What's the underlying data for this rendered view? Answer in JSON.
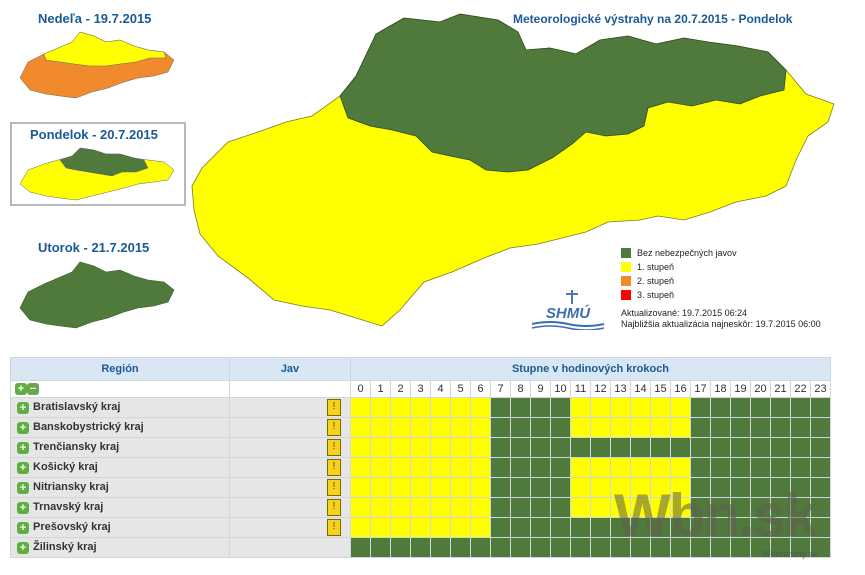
{
  "days": [
    {
      "title": "Nedeľa - 19.7.2015"
    },
    {
      "title": "Pondelok - 20.7.2015"
    },
    {
      "title": "Utorok - 21.7.2015"
    }
  ],
  "main_title": "Meteorologické výstrahy na 20.7.2015 - Pondelok",
  "legend": [
    {
      "label": "Bez nebezpečných javov",
      "color": "#4f7a3c"
    },
    {
      "label": "1. stupeň",
      "color": "#ffff00"
    },
    {
      "label": "2. stupeň",
      "color": "#f08a2c"
    },
    {
      "label": "3. stupeň",
      "color": "#ff0000"
    }
  ],
  "logo": {
    "text": "SHMÚ"
  },
  "update": {
    "updated": "Aktualizované: 19.7.2015 06:24",
    "next": "Najbližšia aktualizácia najneskôr: 19.7.2015 06:00"
  },
  "table": {
    "col_region": "Región",
    "col_jav": "Jav",
    "col_steps": "Stupne v hodinových krokoch",
    "expand_icon": "plus-icon",
    "collapse_icon": "minus-icon",
    "hazard_icon": "thermometer-icon",
    "hours": [
      "0",
      "1",
      "2",
      "3",
      "4",
      "5",
      "6",
      "7",
      "8",
      "9",
      "10",
      "11",
      "12",
      "13",
      "14",
      "15",
      "16",
      "17",
      "18",
      "19",
      "20",
      "21",
      "22",
      "23"
    ],
    "regions": [
      {
        "name": "Bratislavský kraj",
        "hazard": true,
        "levels": [
          1,
          1,
          1,
          1,
          1,
          1,
          1,
          0,
          0,
          0,
          0,
          1,
          1,
          1,
          1,
          1,
          1,
          0,
          0,
          0,
          0,
          0,
          0,
          0
        ]
      },
      {
        "name": "Banskobystrický kraj",
        "hazard": true,
        "levels": [
          1,
          1,
          1,
          1,
          1,
          1,
          1,
          0,
          0,
          0,
          0,
          1,
          1,
          1,
          1,
          1,
          1,
          0,
          0,
          0,
          0,
          0,
          0,
          0
        ]
      },
      {
        "name": "Trenčiansky kraj",
        "hazard": true,
        "levels": [
          1,
          1,
          1,
          1,
          1,
          1,
          1,
          0,
          0,
          0,
          0,
          0,
          0,
          0,
          0,
          0,
          0,
          0,
          0,
          0,
          0,
          0,
          0,
          0
        ]
      },
      {
        "name": "Košický kraj",
        "hazard": true,
        "levels": [
          1,
          1,
          1,
          1,
          1,
          1,
          1,
          0,
          0,
          0,
          0,
          1,
          1,
          1,
          1,
          1,
          1,
          0,
          0,
          0,
          0,
          0,
          0,
          0
        ]
      },
      {
        "name": "Nitriansky kraj",
        "hazard": true,
        "levels": [
          1,
          1,
          1,
          1,
          1,
          1,
          1,
          0,
          0,
          0,
          0,
          1,
          1,
          1,
          1,
          1,
          1,
          0,
          0,
          0,
          0,
          0,
          0,
          0
        ]
      },
      {
        "name": "Trnavský kraj",
        "hazard": true,
        "levels": [
          1,
          1,
          1,
          1,
          1,
          1,
          1,
          0,
          0,
          0,
          0,
          1,
          1,
          1,
          1,
          1,
          1,
          0,
          0,
          0,
          0,
          0,
          0,
          0
        ]
      },
      {
        "name": "Prešovský kraj",
        "hazard": true,
        "levels": [
          1,
          1,
          1,
          1,
          1,
          1,
          1,
          0,
          0,
          0,
          0,
          0,
          0,
          0,
          0,
          0,
          0,
          0,
          0,
          0,
          0,
          0,
          0,
          0
        ]
      },
      {
        "name": "Žilinský kraj",
        "hazard": false,
        "levels": [
          0,
          0,
          0,
          0,
          0,
          0,
          0,
          0,
          0,
          0,
          0,
          0,
          0,
          0,
          0,
          0,
          0,
          0,
          0,
          0,
          0,
          0,
          0,
          0
        ]
      }
    ]
  },
  "watermark": {
    "text": "Wbn.sk",
    "sub": "Webnoviny.sk"
  }
}
